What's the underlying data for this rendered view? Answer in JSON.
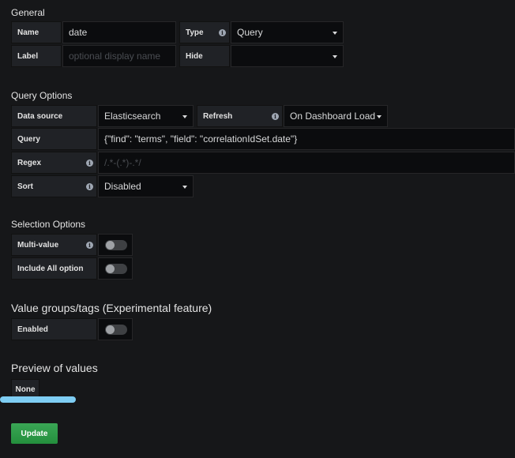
{
  "general": {
    "heading": "General",
    "name_label": "Name",
    "name_value": "date",
    "type_label": "Type",
    "type_value": "Query",
    "label_label": "Label",
    "label_placeholder": "optional display name",
    "hide_label": "Hide",
    "hide_value": ""
  },
  "query_options": {
    "heading": "Query Options",
    "datasource_label": "Data source",
    "datasource_value": "Elasticsearch",
    "refresh_label": "Refresh",
    "refresh_value": "On Dashboard Load",
    "query_label": "Query",
    "query_value": "{\"find\": \"terms\", \"field\": \"correlationIdSet.date\"}",
    "regex_label": "Regex",
    "regex_placeholder": "/.*-(.*)-.*/",
    "sort_label": "Sort",
    "sort_value": "Disabled"
  },
  "selection_options": {
    "heading": "Selection Options",
    "multi_value_label": "Multi-value",
    "multi_value_on": false,
    "include_all_label": "Include All option",
    "include_all_on": false
  },
  "value_groups": {
    "heading": "Value groups/tags (Experimental feature)",
    "enabled_label": "Enabled",
    "enabled_on": false
  },
  "preview": {
    "heading": "Preview of values",
    "values": [
      "None"
    ]
  },
  "actions": {
    "update_label": "Update"
  },
  "colors": {
    "background": "#161719",
    "label_bg": "#202226",
    "input_bg": "#0b0c0e",
    "update_green": "#299c46",
    "highlight_blue": "#7ecdf3"
  },
  "icons": {
    "info": "info-circle-icon",
    "dropdown": "caret-down-icon"
  }
}
